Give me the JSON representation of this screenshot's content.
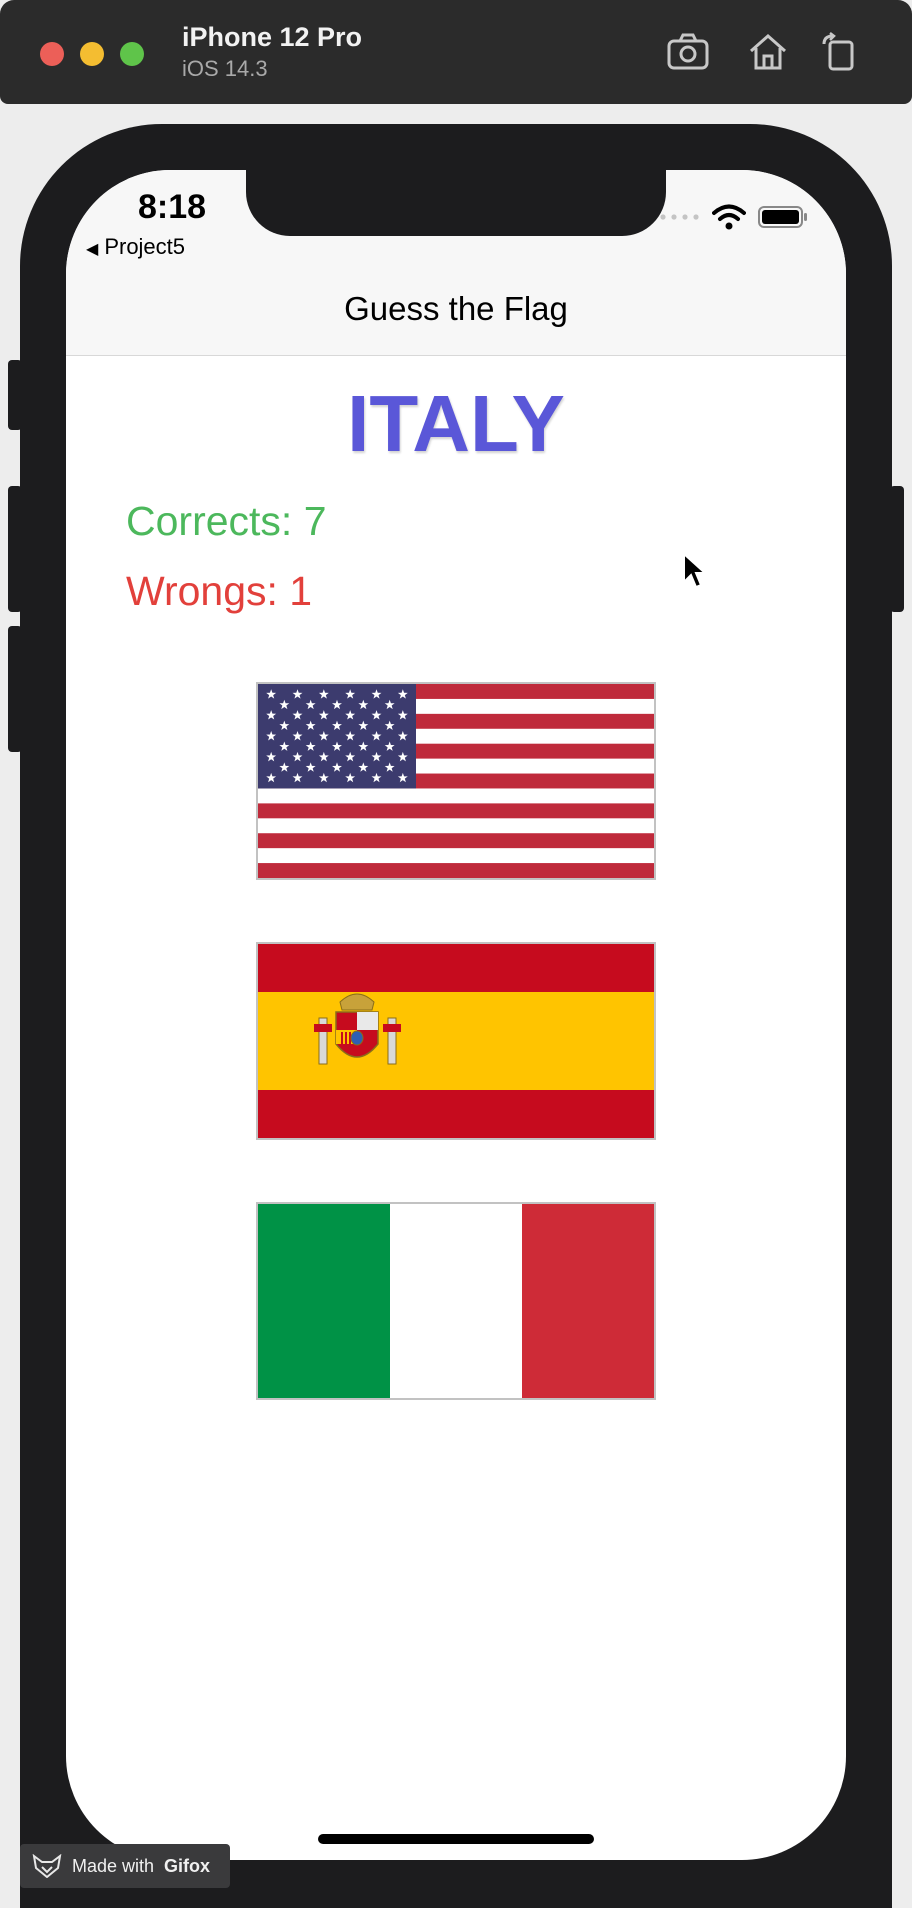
{
  "simulator": {
    "device": "iPhone 12 Pro",
    "os": "iOS 14.3",
    "tools": [
      "screenshot-icon",
      "home-icon",
      "rotate-icon"
    ]
  },
  "status_bar": {
    "time": "8:18",
    "back_label": "Project5"
  },
  "nav": {
    "title": "Guess the Flag"
  },
  "game": {
    "country": "ITALY",
    "correct_text": "Corrects: 7",
    "wrong_text": "Wrongs: 1",
    "flags": [
      "united-states-flag",
      "spain-flag",
      "italy-flag"
    ]
  },
  "watermark": {
    "prefix": "Made with",
    "brand": "Gifox"
  },
  "colors": {
    "title": "#5a57d8",
    "correct": "#4cb85c",
    "wrong": "#e2403b"
  }
}
